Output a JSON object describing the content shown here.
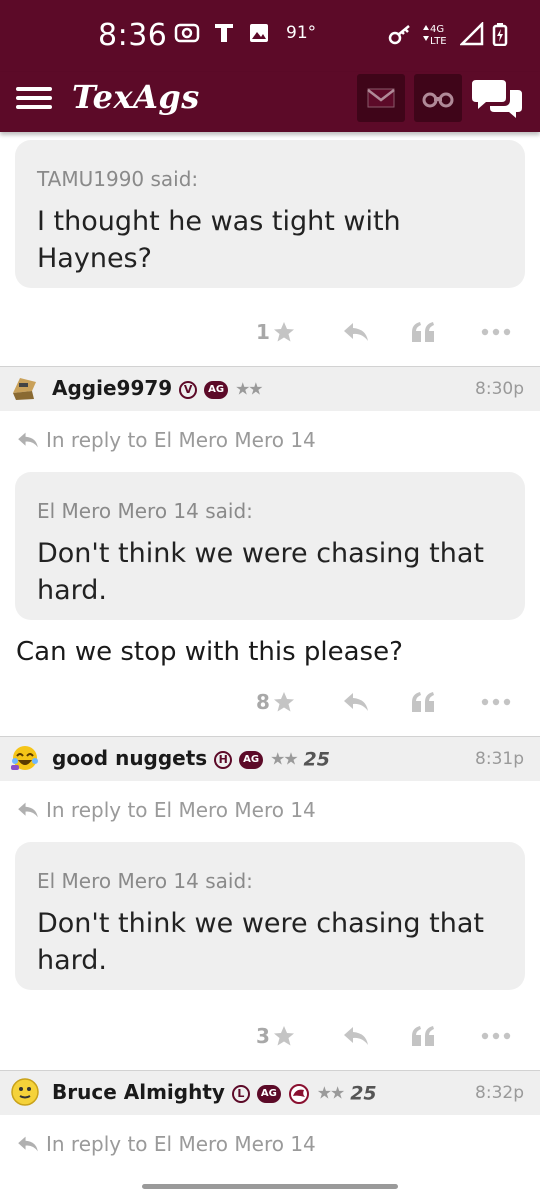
{
  "status_bar": {
    "time": "8:36",
    "temperature": "91°",
    "network": "4G LTE"
  },
  "app_bar": {
    "brand": "TexAgs",
    "icons": [
      "menu-icon",
      "mail-icon",
      "binoculars-icon",
      "chat-icon"
    ],
    "accent": "#5c0a28"
  },
  "top_post": {
    "quote_author": "TAMU1990 said:",
    "quote_text": "I thought he was tight with Haynes?",
    "likes": "1"
  },
  "posts": [
    {
      "username": "Aggie9979",
      "badges": [
        "V",
        "AG",
        "★★"
      ],
      "time": "8:30p",
      "reply_to": "In reply to El Mero Mero 14",
      "quote_author": "El Mero Mero 14 said:",
      "quote_text": "Don't think we were chasing that hard.",
      "body": "Can we stop with this please?",
      "likes": "8"
    },
    {
      "username": "good nuggets",
      "badges": [
        "H",
        "AG",
        "★★",
        "25"
      ],
      "time": "8:31p",
      "reply_to": "In reply to El Mero Mero 14",
      "quote_author": "El Mero Mero 14 said:",
      "quote_text": "Don't think we were chasing that hard.",
      "likes": "3"
    },
    {
      "username": "Bruce Almighty",
      "badges": [
        "L",
        "AG",
        "★★",
        "25"
      ],
      "time": "8:32p",
      "reply_to": "In reply to El Mero Mero 14"
    }
  ]
}
